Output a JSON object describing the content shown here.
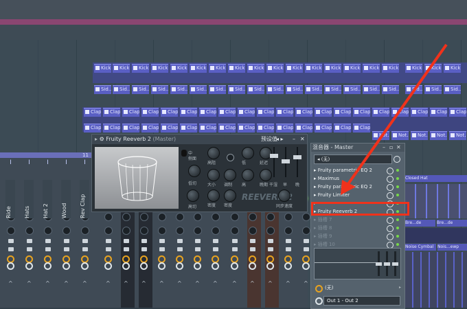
{
  "playlist": {
    "clips_kick_label": "Kick",
    "clips_sid_label": "Sid...er",
    "clips_clap_label": "Clap",
    "clips_not_label": "Not...at",
    "right_clips": {
      "closed_hat": "Closed Hat",
      "bre_de": "Bre...de",
      "noise_cymbal": "Noise Cymbal",
      "nois_sweep": "Nois...ewp"
    }
  },
  "mixer": {
    "track_names": [
      "Ride",
      "Hats",
      "Hat 2",
      "Wood",
      "Rev Clap"
    ],
    "header_num": "11"
  },
  "plugin": {
    "title": "Fruity Reeverb 2",
    "title_suffix": "(Master)",
    "preset_label": "预设值",
    "mode_label": "中",
    "mode_label2": "侧面",
    "knob_labels": [
      "低切",
      "高切",
      "高阻",
      "大小",
      "调制",
      "密度",
      "混合",
      "早期",
      "延迟",
      "晚期"
    ],
    "knob_labels2": [
      "低切",
      "高切",
      "高阻",
      "大小",
      "调制",
      "密度"
    ],
    "slider_labels": [
      "干湿",
      "早",
      "晚"
    ],
    "slider_knob_labels": [
      "混合",
      "早期"
    ],
    "knob_labels_col3": [
      "低",
      "高",
      "延迟",
      "晚期"
    ],
    "extra_labels": [
      "早期",
      "低",
      "合分",
      "量",
      "早期"
    ],
    "logo": "REEVERB 2",
    "brand": "冷",
    "sync_label": "同步速度"
  },
  "rack": {
    "title": "混音器 - Master",
    "preset_value": "(无)",
    "slots": [
      "Fruity parametric EQ 2",
      "Maximus",
      "Fruity parametric EQ 2",
      "Fruity Limiter",
      "",
      "Fruity Reeverb 2",
      "插槽 7",
      "插槽 8",
      "插槽 9",
      "插槽 10"
    ],
    "input_label": "(无)",
    "output_label": "Out 1 - Out 2"
  },
  "colors": {
    "accent_red": "#f0321b",
    "clip_blue": "#5a5fc4",
    "led_green": "#7fe04f"
  }
}
